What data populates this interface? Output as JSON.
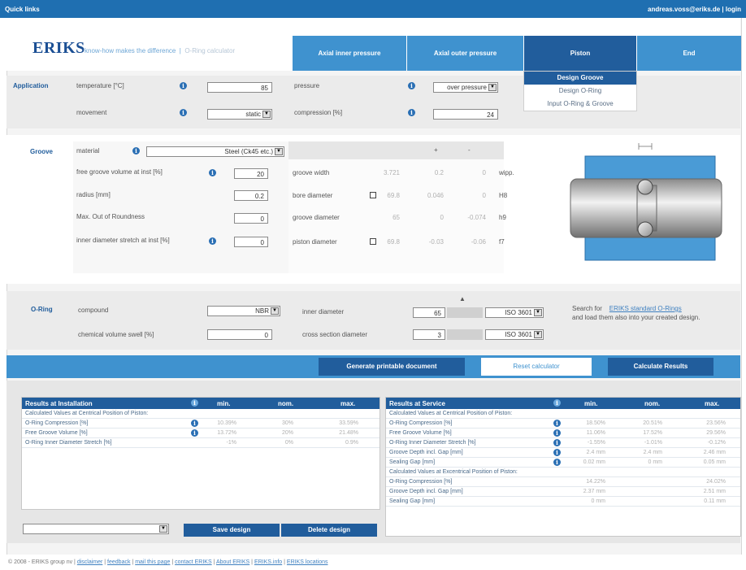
{
  "topbar": {
    "quick_links": "Quick links",
    "user": "andreas.voss@eriks.de | login"
  },
  "brand": {
    "logo": "ERIKS",
    "tagline": "know-how makes the difference",
    "calc": "O-Ring calculator"
  },
  "tabs": [
    {
      "label": "Axial inner pressure"
    },
    {
      "label": "Axial outer pressure"
    },
    {
      "label": "Piston"
    },
    {
      "label": "End"
    }
  ],
  "submenu": [
    "Design Groove",
    "Design O-Ring",
    "Input O-Ring & Groove"
  ],
  "application": {
    "title": "Application",
    "temperature_label": "temperature [°C]",
    "temperature_value": "85",
    "movement_label": "movement",
    "movement_value": "static",
    "pressure_label": "pressure",
    "pressure_value": "over pressure",
    "compression_label": "compression [%]",
    "compression_value": "24"
  },
  "groove": {
    "title": "Groove",
    "material_label": "material",
    "material_value": "Steel (Ck45 etc.)",
    "col_plus": "+",
    "col_minus": "-",
    "left_rows": [
      {
        "label": "free groove volume at inst [%]",
        "value": "20",
        "info": true
      },
      {
        "label": "radius [mm]",
        "value": "0.2",
        "info": false
      },
      {
        "label": "Max. Out of Roundness",
        "value": "0",
        "info": false
      },
      {
        "label": "inner diameter stretch at inst [%]",
        "value": "0",
        "info": true
      }
    ],
    "right_rows": [
      {
        "label": "groove width",
        "check": false,
        "v1": "3.721",
        "v2": "0.2",
        "v3": "0",
        "v4": "wipp."
      },
      {
        "label": "bore diameter",
        "check": true,
        "v1": "69.8",
        "v2": "0.046",
        "v3": "0",
        "v4": "H8"
      },
      {
        "label": "groove diameter",
        "check": false,
        "v1": "65",
        "v2": "0",
        "v3": "-0.074",
        "v4": "h9"
      },
      {
        "label": "piston diameter",
        "check": true,
        "v1": "69.8",
        "v2": "-0.03",
        "v3": "-0.06",
        "v4": "f7"
      }
    ]
  },
  "oring": {
    "title": "O-Ring",
    "compound_label": "compound",
    "compound_value": "NBR",
    "swell_label": "chemical volume swell [%]",
    "swell_value": "0",
    "id_label": "inner diameter",
    "id_value": "65",
    "id_std": "ISO 3601",
    "cs_label": "cross section diameter",
    "cs_value": "3",
    "cs_std": "ISO 3601",
    "search_text": "Search for",
    "search_link": "ERIKS standard O-Rings",
    "search_text2": "and load them also into your created design."
  },
  "buttons": {
    "generate": "Generate printable document",
    "reset": "Reset calculator",
    "calculate": "Calculate Results"
  },
  "results_install": {
    "title": "Results at Installation",
    "cols": [
      "min.",
      "nom.",
      "max."
    ],
    "subheader": "Calculated Values at Centrical Position of Piston:",
    "rows": [
      {
        "label": "O-Ring Compression [%]",
        "min": "10.39%",
        "nom": "30%",
        "max": "33.59%"
      },
      {
        "label": "Free Groove Volume [%]",
        "min": "13.72%",
        "nom": "20%",
        "max": "21.48%"
      },
      {
        "label": "O-Ring Inner Diameter Stretch [%]",
        "min": "-1%",
        "nom": "0%",
        "max": "0.9%"
      }
    ]
  },
  "results_service": {
    "title": "Results at Service",
    "cols": [
      "min.",
      "nom.",
      "max."
    ],
    "subheader1": "Calculated Values at Centrical Position of Piston:",
    "rows1": [
      {
        "label": "O-Ring Compression [%]",
        "min": "18.50%",
        "nom": "20.51%",
        "max": "23.56%"
      },
      {
        "label": "Free Groove Volume [%]",
        "min": "11.06%",
        "nom": "17.52%",
        "max": "29.56%"
      },
      {
        "label": "O-Ring Inner Diameter Stretch [%]",
        "min": "-1.55%",
        "nom": "-1.01%",
        "max": "-0.12%"
      },
      {
        "label": "Groove Depth incl. Gap [mm]",
        "min": "2.4 mm",
        "nom": "2.4 mm",
        "max": "2.46 mm"
      },
      {
        "label": "Sealing Gap [mm]",
        "min": "0.02 mm",
        "nom": "0 mm",
        "max": "0.05 mm"
      }
    ],
    "subheader2": "Calculated Values at Excentrical Position of Piston:",
    "rows2": [
      {
        "label": "O-Ring Compression [%]",
        "min": "14.22%",
        "nom": "",
        "max": "24.02%"
      },
      {
        "label": "Groove Depth incl. Gap [mm]",
        "min": "2.37 mm",
        "nom": "",
        "max": "2.51 mm"
      },
      {
        "label": "Sealing Gap [mm]",
        "min": "0 mm",
        "nom": "",
        "max": "0.11 mm"
      }
    ]
  },
  "design": {
    "save": "Save design",
    "delete": "Delete design",
    "select_value": ""
  },
  "footer": {
    "copyright": "© 2008 - ERIKS group nv |",
    "links": [
      "disclaimer",
      "feedback",
      "mail this page",
      "contact ERIKS",
      "About ERIKS",
      "ERIKS.info",
      "ERIKS locations"
    ]
  }
}
